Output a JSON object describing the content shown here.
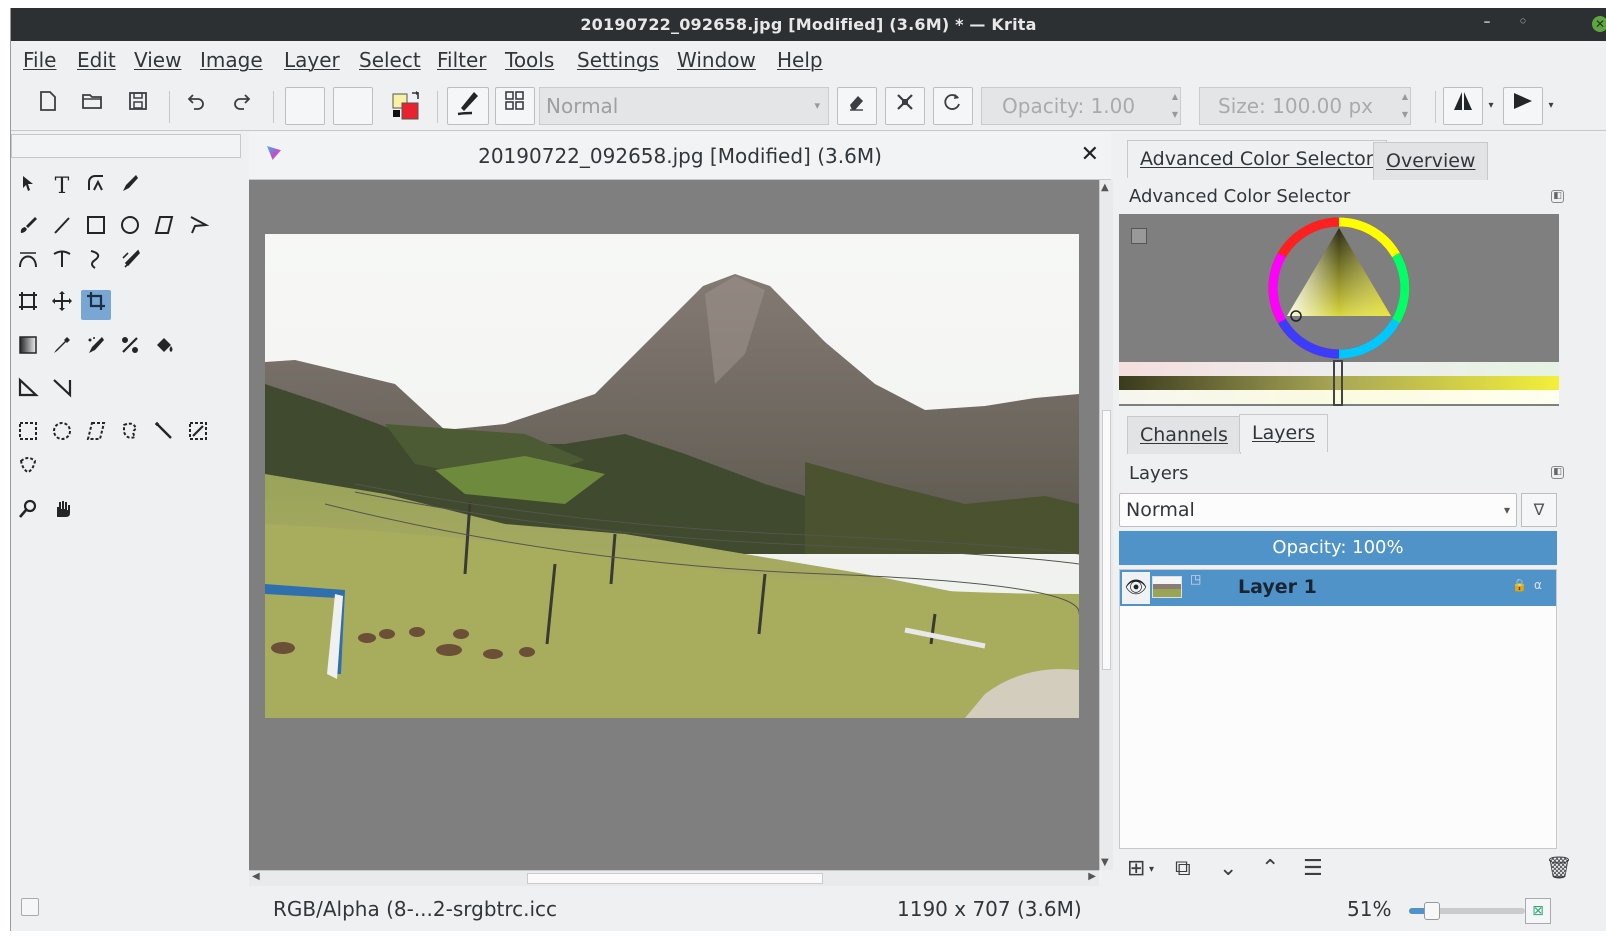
{
  "window": {
    "title": "20190722_092658.jpg [Modified]  (3.6M) * — Krita",
    "minimize_glyph": "–",
    "restore_glyph": "◦",
    "close_glyph": "✕"
  },
  "menu": [
    "File",
    "Edit",
    "View",
    "Image",
    "Layer",
    "Select",
    "Filter",
    "Tools",
    "Settings",
    "Window",
    "Help"
  ],
  "toolbar": {
    "blend_mode": "Normal",
    "opacity_label": "Opacity:  1.00",
    "size_label": "Size:  100.00 px",
    "icons": [
      "new-document-icon",
      "open-folder-icon",
      "save-icon",
      "undo-icon",
      "redo-icon",
      "gradient-swatch",
      "pattern-swatch",
      "color-swap-icon",
      "brush-preset-icon",
      "brush-presets-grid-icon",
      "eraser-icon",
      "preserve-alpha-icon",
      "reload-preset-icon",
      "mirror-horizontal-icon",
      "mirror-vertical-icon"
    ]
  },
  "toolbox": {
    "tools": [
      "select-shapes",
      "text",
      "edit-shapes",
      "calligraphy",
      "freehand-brush",
      "line",
      "rectangle",
      "ellipse",
      "polygon",
      "polyline",
      "bezier",
      "freehand-path",
      "dynamic-brush",
      "multibrush",
      "transform",
      "move",
      "crop",
      "gradient",
      "color-picker",
      "smart-patch",
      "fill",
      "assistant",
      "measure",
      "rectangular-select",
      "elliptical-select",
      "polygonal-select",
      "freehand-select",
      "contiguous-select",
      "similar-select",
      "bezier-select",
      "magnetic-select",
      "zoom",
      "pan"
    ],
    "active_tool": "crop"
  },
  "document": {
    "tab_title": "20190722_092658.jpg [Modified]  (3.6M)",
    "close_glyph": "✕"
  },
  "color_docker": {
    "tabs": [
      "Advanced Color Selector",
      "Overview"
    ],
    "active_tab": "Advanced Color Selector",
    "panel_title": "Advanced Color Selector",
    "selected_color": "#f2ee39"
  },
  "layers_docker": {
    "tabs": [
      "Channels",
      "Layers"
    ],
    "active_tab": "Layers",
    "panel_title": "Layers",
    "blend_mode": "Normal",
    "opacity_label": "Opacity:  100%",
    "layers": [
      {
        "name": "Layer 1",
        "visible": true,
        "selected": true
      }
    ],
    "accent": "#4f93c8"
  },
  "statusbar": {
    "color_profile": "RGB/Alpha (8-...2-srgbtrc.icc",
    "image_size": "1190 x 707 (3.6M)",
    "zoom": "51%",
    "zoom_fraction": 0.2
  }
}
